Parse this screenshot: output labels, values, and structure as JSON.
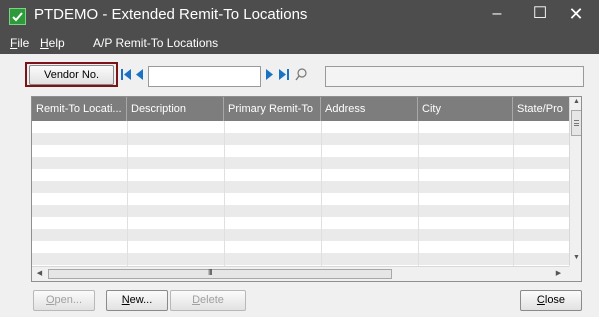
{
  "window": {
    "title": "PTDEMO - Extended Remit-To Locations",
    "minimize_glyph": "–",
    "maximize_glyph": "☐",
    "close_glyph": "✕"
  },
  "menu": {
    "file_underline": "F",
    "file_rest": "ile",
    "help_underline": "H",
    "help_rest": "elp",
    "remit_to": "A/P Remit-To Locations"
  },
  "toolbar": {
    "vendor_button": "Vendor No.",
    "vendor_value": "",
    "vendor_name_value": "",
    "icons": [
      "first-record-icon",
      "previous-record-icon",
      "next-record-icon",
      "last-record-icon",
      "finder-icon"
    ]
  },
  "grid": {
    "columns": [
      "Remit-To Locati...",
      "Description",
      "Primary Remit-To",
      "Address",
      "City",
      "State/Pro"
    ],
    "rows": [],
    "hscroll_grip": "III"
  },
  "buttons": {
    "open_underline": "O",
    "open_rest": "pen...",
    "new_underline": "N",
    "new_rest": "ew...",
    "delete_underline": "D",
    "delete_rest": "elete",
    "close_underline": "C",
    "close_rest": "lose"
  },
  "colors": {
    "titlebar": "#4d4d4d",
    "highlight_border": "#7a1416",
    "nav_arrow": "#1a72c4",
    "grid_header": "#7d7d7d",
    "alt_row": "#eaeaea"
  }
}
